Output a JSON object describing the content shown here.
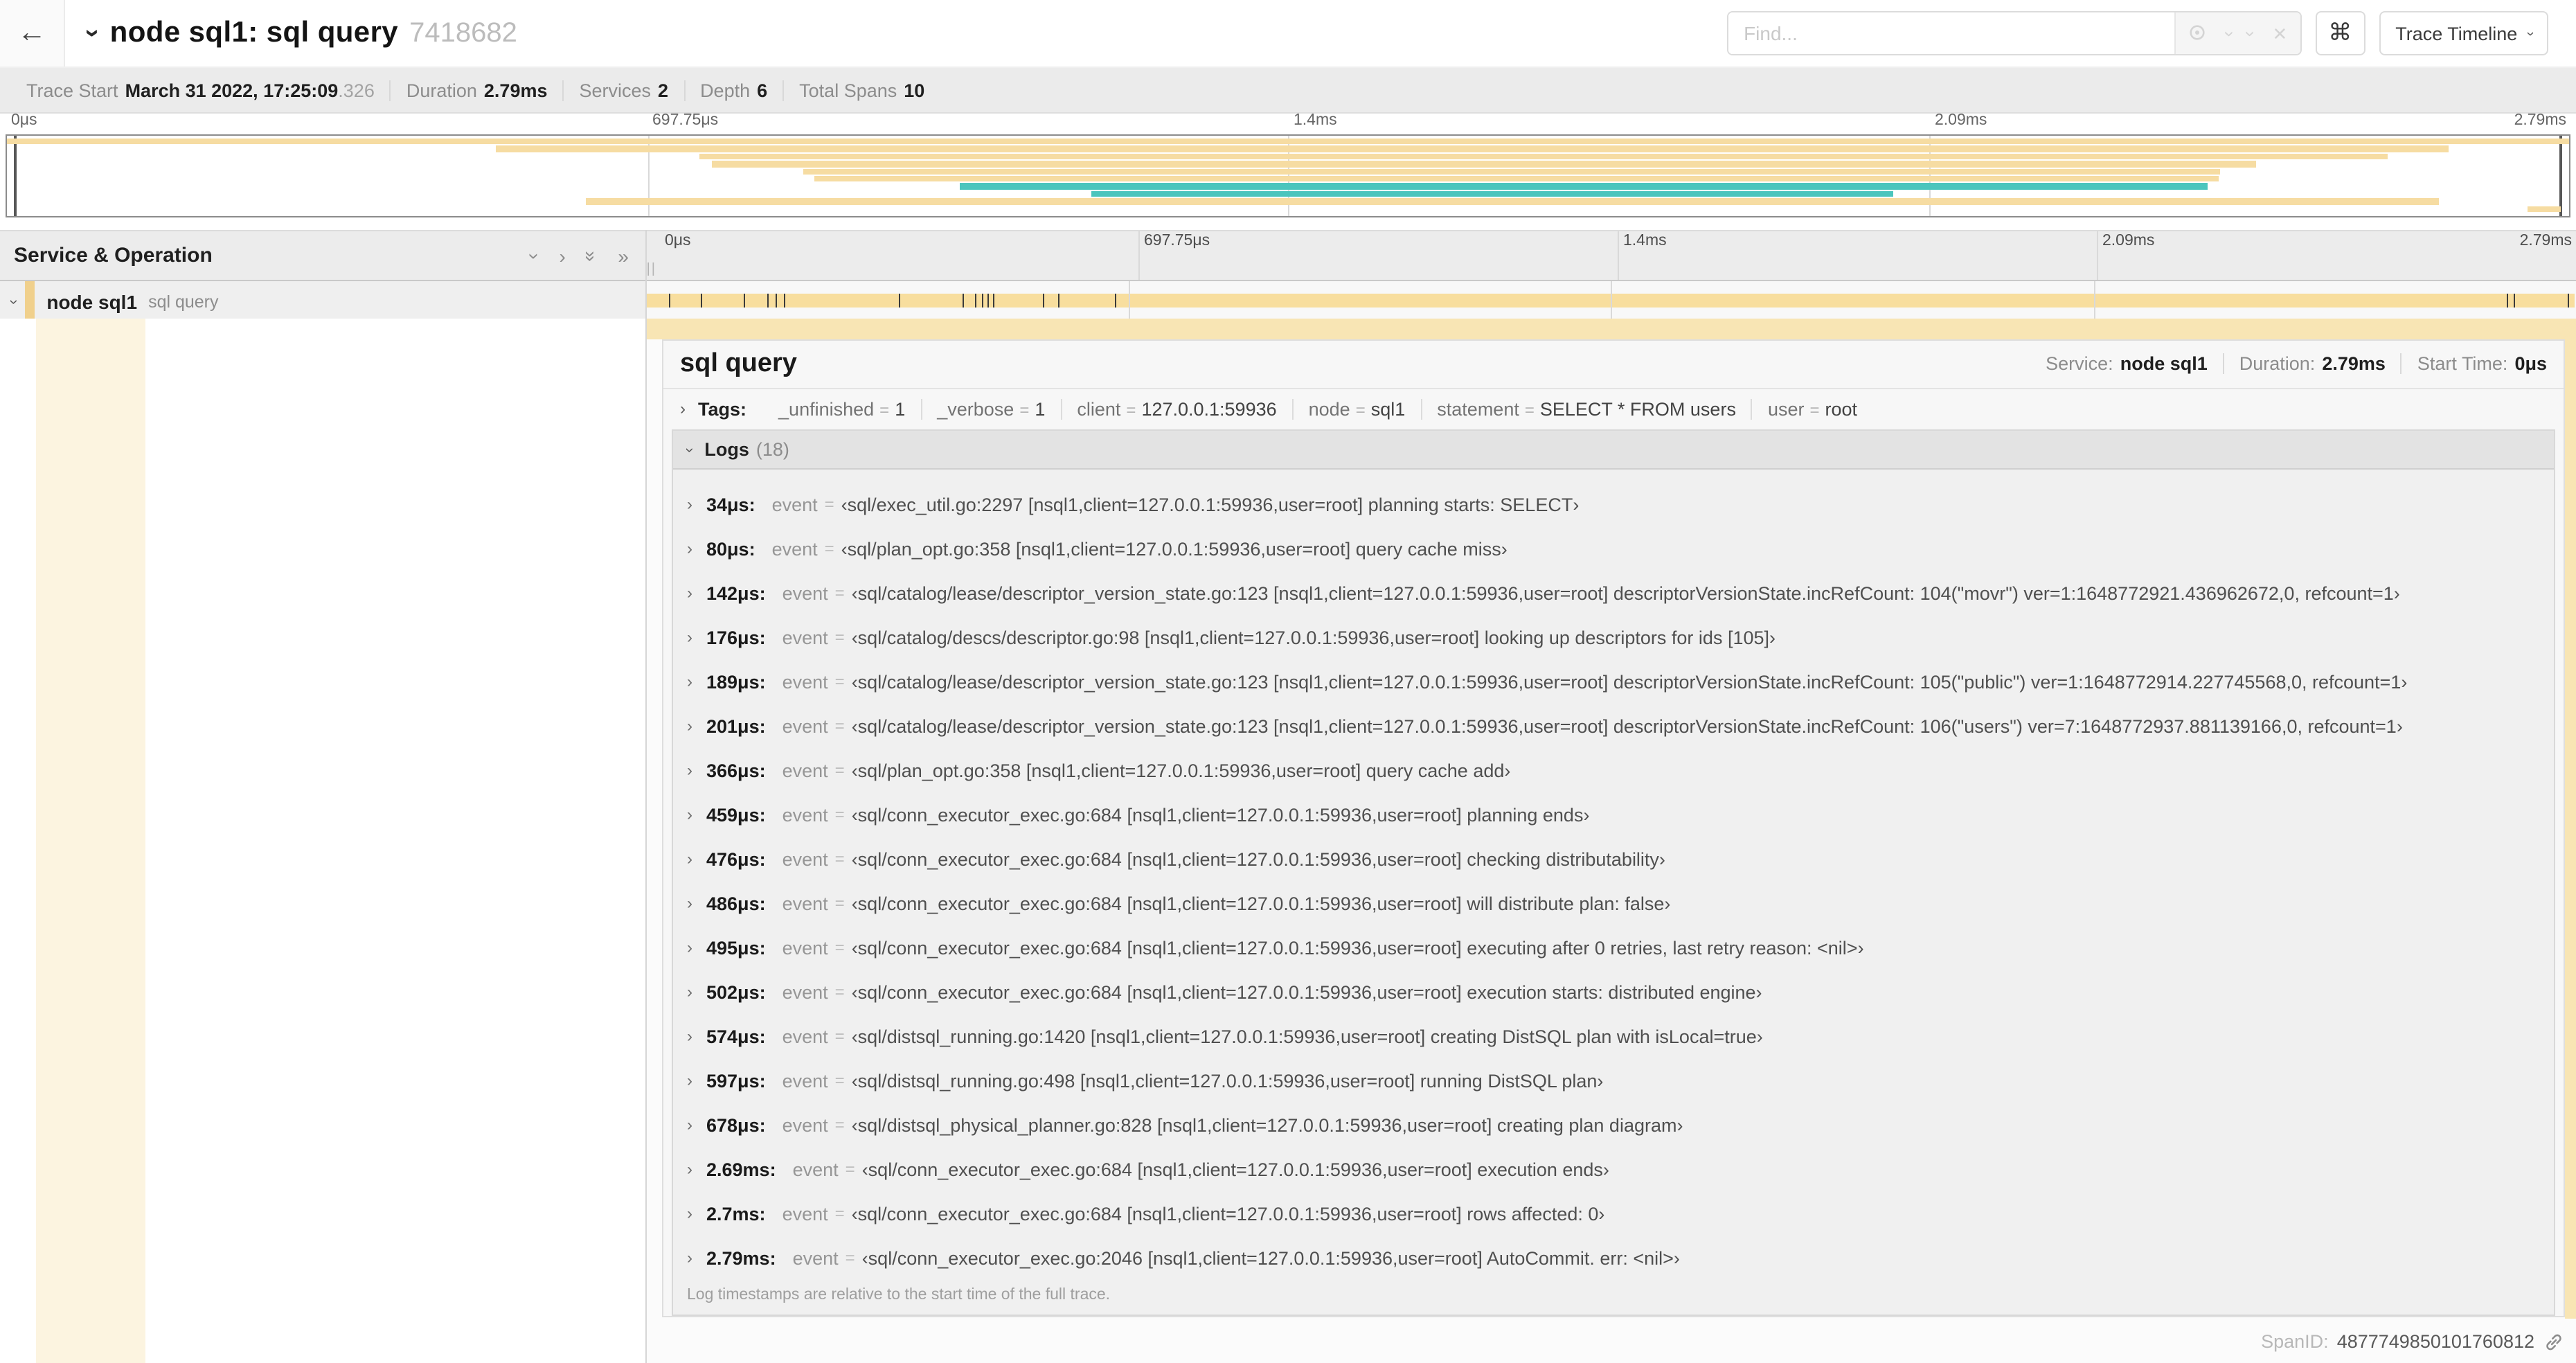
{
  "header": {
    "back_icon": "←",
    "collapse_icon": "›",
    "title": "node sql1: sql query",
    "trace_id": "7418682",
    "find_placeholder": "Find...",
    "tools": {
      "prev_icon": "‹",
      "next_icon": "›",
      "clear_icon": "✕"
    },
    "command_icon": "⌘",
    "view_button": "Trace Timeline"
  },
  "trace_info": {
    "items": [
      {
        "label": "Trace Start",
        "value": "March 31 2022, 17:25:09",
        "suffix": ".326"
      },
      {
        "label": "Duration",
        "value": "2.79ms"
      },
      {
        "label": "Services",
        "value": "2"
      },
      {
        "label": "Depth",
        "value": "6"
      },
      {
        "label": "Total Spans",
        "value": "10"
      }
    ]
  },
  "timeline": {
    "duration_us": 2790,
    "ticks": [
      {
        "label": "0μs",
        "pct": 0
      },
      {
        "label": "697.75μs",
        "pct": 25
      },
      {
        "label": "1.4ms",
        "pct": 50
      },
      {
        "label": "2.09ms",
        "pct": 75
      },
      {
        "label": "2.79ms",
        "pct": 100
      }
    ]
  },
  "minimap": {
    "colors": {
      "y": "#F6DCA2",
      "t": "#4BC5BD"
    },
    "spans": [
      {
        "s": 0,
        "e": 100,
        "c": "y"
      },
      {
        "s": 19.1,
        "e": 95.3,
        "c": "y"
      },
      {
        "s": 27.0,
        "e": 92.9,
        "c": "y"
      },
      {
        "s": 27.5,
        "e": 87.8,
        "c": "y"
      },
      {
        "s": 31.1,
        "e": 86.4,
        "c": "y"
      },
      {
        "s": 31.5,
        "e": 86.3,
        "c": "y"
      },
      {
        "s": 37.2,
        "e": 85.9,
        "c": "t"
      },
      {
        "s": 42.3,
        "e": 73.6,
        "c": "t"
      },
      {
        "s": 22.6,
        "e": 94.9,
        "c": "y"
      },
      {
        "s": 98.4,
        "e": 99.7,
        "c": "y"
      }
    ]
  },
  "left_panel": {
    "title": "Service & Operation"
  },
  "span_row": {
    "service": "node sql1",
    "operation": "sql query"
  },
  "detail": {
    "title": "sql query",
    "meta": [
      {
        "label": "Service:",
        "value": "node sql1"
      },
      {
        "label": "Duration:",
        "value": "2.79ms"
      },
      {
        "label": "Start Time:",
        "value": "0μs"
      }
    ],
    "tags_label": "Tags:",
    "tags": [
      {
        "key": "_unfinished",
        "value": "1"
      },
      {
        "key": "_verbose",
        "value": "1"
      },
      {
        "key": "client",
        "value": "127.0.0.1:59936"
      },
      {
        "key": "node",
        "value": "sql1"
      },
      {
        "key": "statement",
        "value": "SELECT * FROM users"
      },
      {
        "key": "user",
        "value": "root"
      }
    ],
    "logs_label": "Logs",
    "logs_count": "(18)",
    "log_field": "event",
    "logs": [
      {
        "t_us": 34,
        "time": "34μs:",
        "value": "‹sql/exec_util.go:2297 [nsql1,client=127.0.0.1:59936,user=root] planning starts: SELECT›"
      },
      {
        "t_us": 80,
        "time": "80μs:",
        "value": "‹sql/plan_opt.go:358 [nsql1,client=127.0.0.1:59936,user=root] query cache miss›"
      },
      {
        "t_us": 142,
        "time": "142μs:",
        "value": "‹sql/catalog/lease/descriptor_version_state.go:123 [nsql1,client=127.0.0.1:59936,user=root] descriptorVersionState.incRefCount: 104(\"movr\") ver=1:1648772921.436962672,0, refcount=1›"
      },
      {
        "t_us": 176,
        "time": "176μs:",
        "value": "‹sql/catalog/descs/descriptor.go:98 [nsql1,client=127.0.0.1:59936,user=root] looking up descriptors for ids [105]›"
      },
      {
        "t_us": 189,
        "time": "189μs:",
        "value": "‹sql/catalog/lease/descriptor_version_state.go:123 [nsql1,client=127.0.0.1:59936,user=root] descriptorVersionState.incRefCount: 105(\"public\") ver=1:1648772914.227745568,0, refcount=1›"
      },
      {
        "t_us": 201,
        "time": "201μs:",
        "value": "‹sql/catalog/lease/descriptor_version_state.go:123 [nsql1,client=127.0.0.1:59936,user=root] descriptorVersionState.incRefCount: 106(\"users\") ver=7:1648772937.881139166,0, refcount=1›"
      },
      {
        "t_us": 366,
        "time": "366μs:",
        "value": "‹sql/plan_opt.go:358 [nsql1,client=127.0.0.1:59936,user=root] query cache add›"
      },
      {
        "t_us": 459,
        "time": "459μs:",
        "value": "‹sql/conn_executor_exec.go:684 [nsql1,client=127.0.0.1:59936,user=root] planning ends›"
      },
      {
        "t_us": 476,
        "time": "476μs:",
        "value": "‹sql/conn_executor_exec.go:684 [nsql1,client=127.0.0.1:59936,user=root] checking distributability›"
      },
      {
        "t_us": 486,
        "time": "486μs:",
        "value": "‹sql/conn_executor_exec.go:684 [nsql1,client=127.0.0.1:59936,user=root] will distribute plan: false›"
      },
      {
        "t_us": 495,
        "time": "495μs:",
        "value": "‹sql/conn_executor_exec.go:684 [nsql1,client=127.0.0.1:59936,user=root] executing after 0 retries, last retry reason: <nil>›"
      },
      {
        "t_us": 502,
        "time": "502μs:",
        "value": "‹sql/conn_executor_exec.go:684 [nsql1,client=127.0.0.1:59936,user=root] execution starts: distributed engine›"
      },
      {
        "t_us": 574,
        "time": "574μs:",
        "value": "‹sql/distsql_running.go:1420 [nsql1,client=127.0.0.1:59936,user=root] creating DistSQL plan with isLocal=true›"
      },
      {
        "t_us": 597,
        "time": "597μs:",
        "value": "‹sql/distsql_running.go:498 [nsql1,client=127.0.0.1:59936,user=root] running DistSQL plan›"
      },
      {
        "t_us": 678,
        "time": "678μs:",
        "value": "‹sql/distsql_physical_planner.go:828 [nsql1,client=127.0.0.1:59936,user=root] creating plan diagram›"
      },
      {
        "t_us": 2690,
        "time": "2.69ms:",
        "value": "‹sql/conn_executor_exec.go:684 [nsql1,client=127.0.0.1:59936,user=root] execution ends›"
      },
      {
        "t_us": 2700,
        "time": "2.7ms:",
        "value": "‹sql/conn_executor_exec.go:684 [nsql1,client=127.0.0.1:59936,user=root] rows affected: 0›"
      },
      {
        "t_us": 2790,
        "time": "2.79ms:",
        "value": "‹sql/conn_executor_exec.go:2046 [nsql1,client=127.0.0.1:59936,user=root] AutoCommit. err: <nil>›"
      }
    ],
    "footer": "Log timestamps are relative to the start time of the full trace.",
    "span_id_label": "SpanID:",
    "span_id": "4877749850101760812"
  }
}
